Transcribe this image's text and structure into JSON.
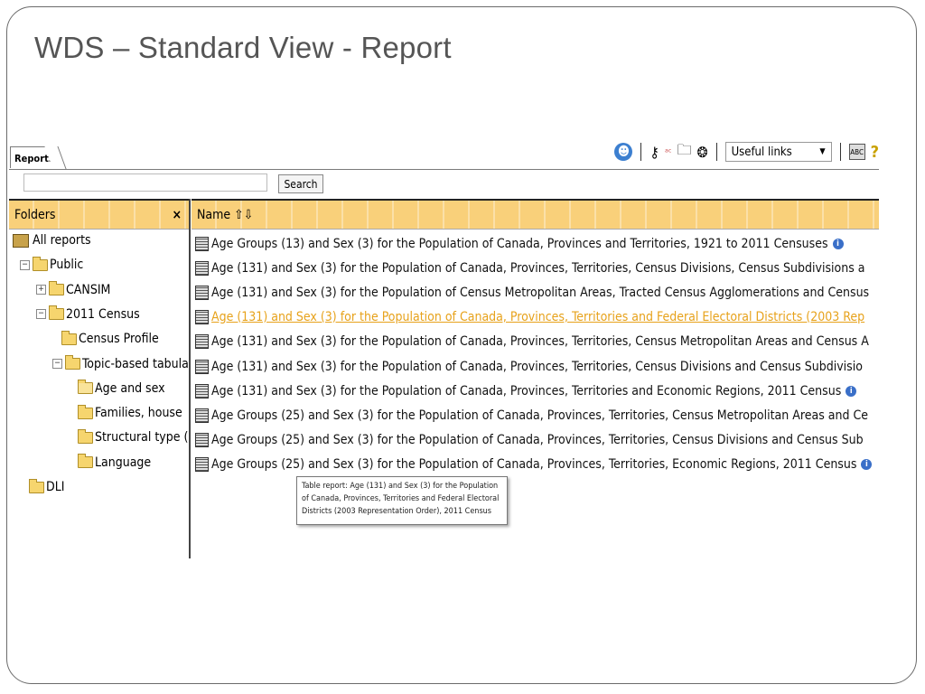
{
  "slide": {
    "title": "WDS – Standard View - Report"
  },
  "tabs": [
    {
      "label": "Reports"
    }
  ],
  "toolbar": {
    "useful_links": "Useful links",
    "icons": [
      "accessibility-icon",
      "key-icon",
      "abc-language-icon",
      "folder-icon",
      "network-icon",
      "abc-dictionary-icon",
      "help-icon"
    ]
  },
  "search": {
    "button_label": "Search",
    "value": ""
  },
  "folders": {
    "header": "Folders",
    "close_glyph": "×",
    "tree": [
      {
        "label": "All reports",
        "level": 0,
        "icon": "all-reports-icon"
      },
      {
        "label": "Public",
        "level": 0,
        "expander": "⊟",
        "icon": "folder-icon"
      },
      {
        "label": "CANSIM",
        "level": 1,
        "expander": "⊞",
        "icon": "folder-icon"
      },
      {
        "label": "2011 Census",
        "level": 1,
        "expander": "⊟",
        "icon": "folder-icon"
      },
      {
        "label": "Census Profile",
        "level": 2,
        "icon": "folder-icon"
      },
      {
        "label": "Topic-based tabula",
        "level": 2,
        "expander": "⊟",
        "icon": "folder-icon"
      },
      {
        "label": "Age and sex",
        "level": 3,
        "icon": "folder-open-icon",
        "selected": true
      },
      {
        "label": "Families, house",
        "level": 3,
        "icon": "folder-icon"
      },
      {
        "label": "Structural type (",
        "level": 3,
        "icon": "folder-icon"
      },
      {
        "label": "Language",
        "level": 3,
        "icon": "folder-icon"
      },
      {
        "label": "DLI",
        "level": 0,
        "icon": "folder-icon"
      }
    ]
  },
  "list": {
    "header": "Name",
    "sort_glyph": "⇧⇩",
    "rows": [
      {
        "label": "Age Groups (13) and Sex (3) for the Population of Canada, Provinces and Territories, 1921 to 2011 Censuses",
        "info": true
      },
      {
        "label": "Age (131) and Sex (3) for the Population of Canada, Provinces, Territories, Census Divisions, Census Subdivisions a"
      },
      {
        "label": "Age (131) and Sex (3) for the Population of Census Metropolitan Areas, Tracted Census Agglomerations and Census"
      },
      {
        "label": "Age (131) and Sex (3) for the Population of Canada, Provinces, Territories and Federal Electoral Districts (2003 Rep",
        "highlight": true
      },
      {
        "label": "Age (131) and Sex (3) for the Population of Canada, Provinces, Territories, Census Metropolitan Areas and Census A"
      },
      {
        "label": "Age (131) and Sex (3) for the Population of Canada, Provinces, Territories, Census Divisions and Census Subdivisio"
      },
      {
        "label": "Age (131) and Sex (3) for the Population of Canada, Provinces, Territories and Economic Regions, 2011 Census",
        "info": true
      },
      {
        "label": "Age Groups (25) and Sex (3) for the Population of Canada, Provinces, Territories, Census Metropolitan Areas and Ce"
      },
      {
        "label": "Age Groups (25) and Sex (3) for the Population of Canada, Provinces, Territories, Census Divisions and Census Sub"
      },
      {
        "label": "Age Groups (25) and Sex (3) for the Population of Canada, Provinces, Territories, Economic Regions, 2011 Census",
        "info": true
      }
    ]
  },
  "tooltip": {
    "text": "Table report: Age (131) and Sex (3) for the Population of Canada, Provinces, Territories and Federal Electoral Districts (2003 Representation Order), 2011 Census"
  }
}
